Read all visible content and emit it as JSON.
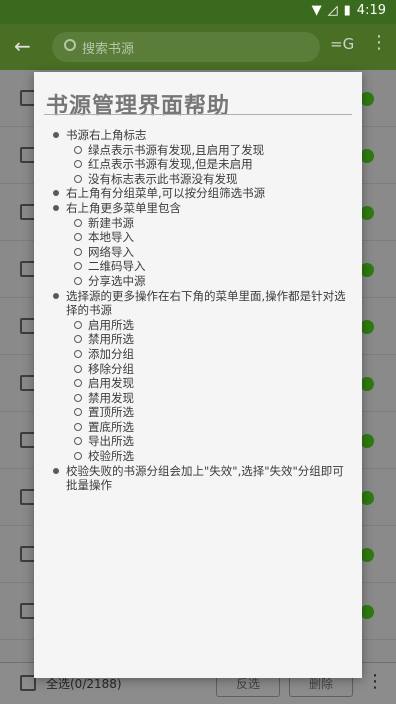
{
  "status_bar": {
    "time": "4:19",
    "icons": [
      "wifi-icon",
      "signal-off-icon",
      "battery-icon"
    ]
  },
  "app_bar": {
    "search_placeholder": "搜索书源",
    "group_label": "=G"
  },
  "bottom_bar": {
    "select_all_label": "全选(0/2188)",
    "invert_label": "反选",
    "delete_label": "删除"
  },
  "help": {
    "title": "书源管理界面帮助",
    "items": [
      {
        "text": "书源右上角标志",
        "sub": [
          "绿点表示书源有发现,且启用了发现",
          "红点表示书源有发现,但是未启用",
          "没有标志表示此书源没有发现"
        ]
      },
      {
        "text": "右上角有分组菜单,可以按分组筛选书源",
        "sub": []
      },
      {
        "text": "右上角更多菜单里包含",
        "sub": [
          "新建书源",
          "本地导入",
          "网络导入",
          "二维码导入",
          "分享选中源"
        ]
      },
      {
        "text": "选择源的更多操作在右下角的菜单里面,操作都是针对选择的书源",
        "sub": [
          "启用所选",
          "禁用所选",
          "添加分组",
          "移除分组",
          "启用发现",
          "禁用发现",
          "置顶所选",
          "置底所选",
          "导出所选",
          "校验所选"
        ]
      },
      {
        "text": "校验失败的书源分组会加上\"失效\",选择\"失效\"分组即可批量操作",
        "sub": []
      }
    ]
  },
  "colors": {
    "app_bar": "#486f23",
    "status_bar": "#3a6a1d",
    "enabled_dot": "#2f7a11"
  }
}
